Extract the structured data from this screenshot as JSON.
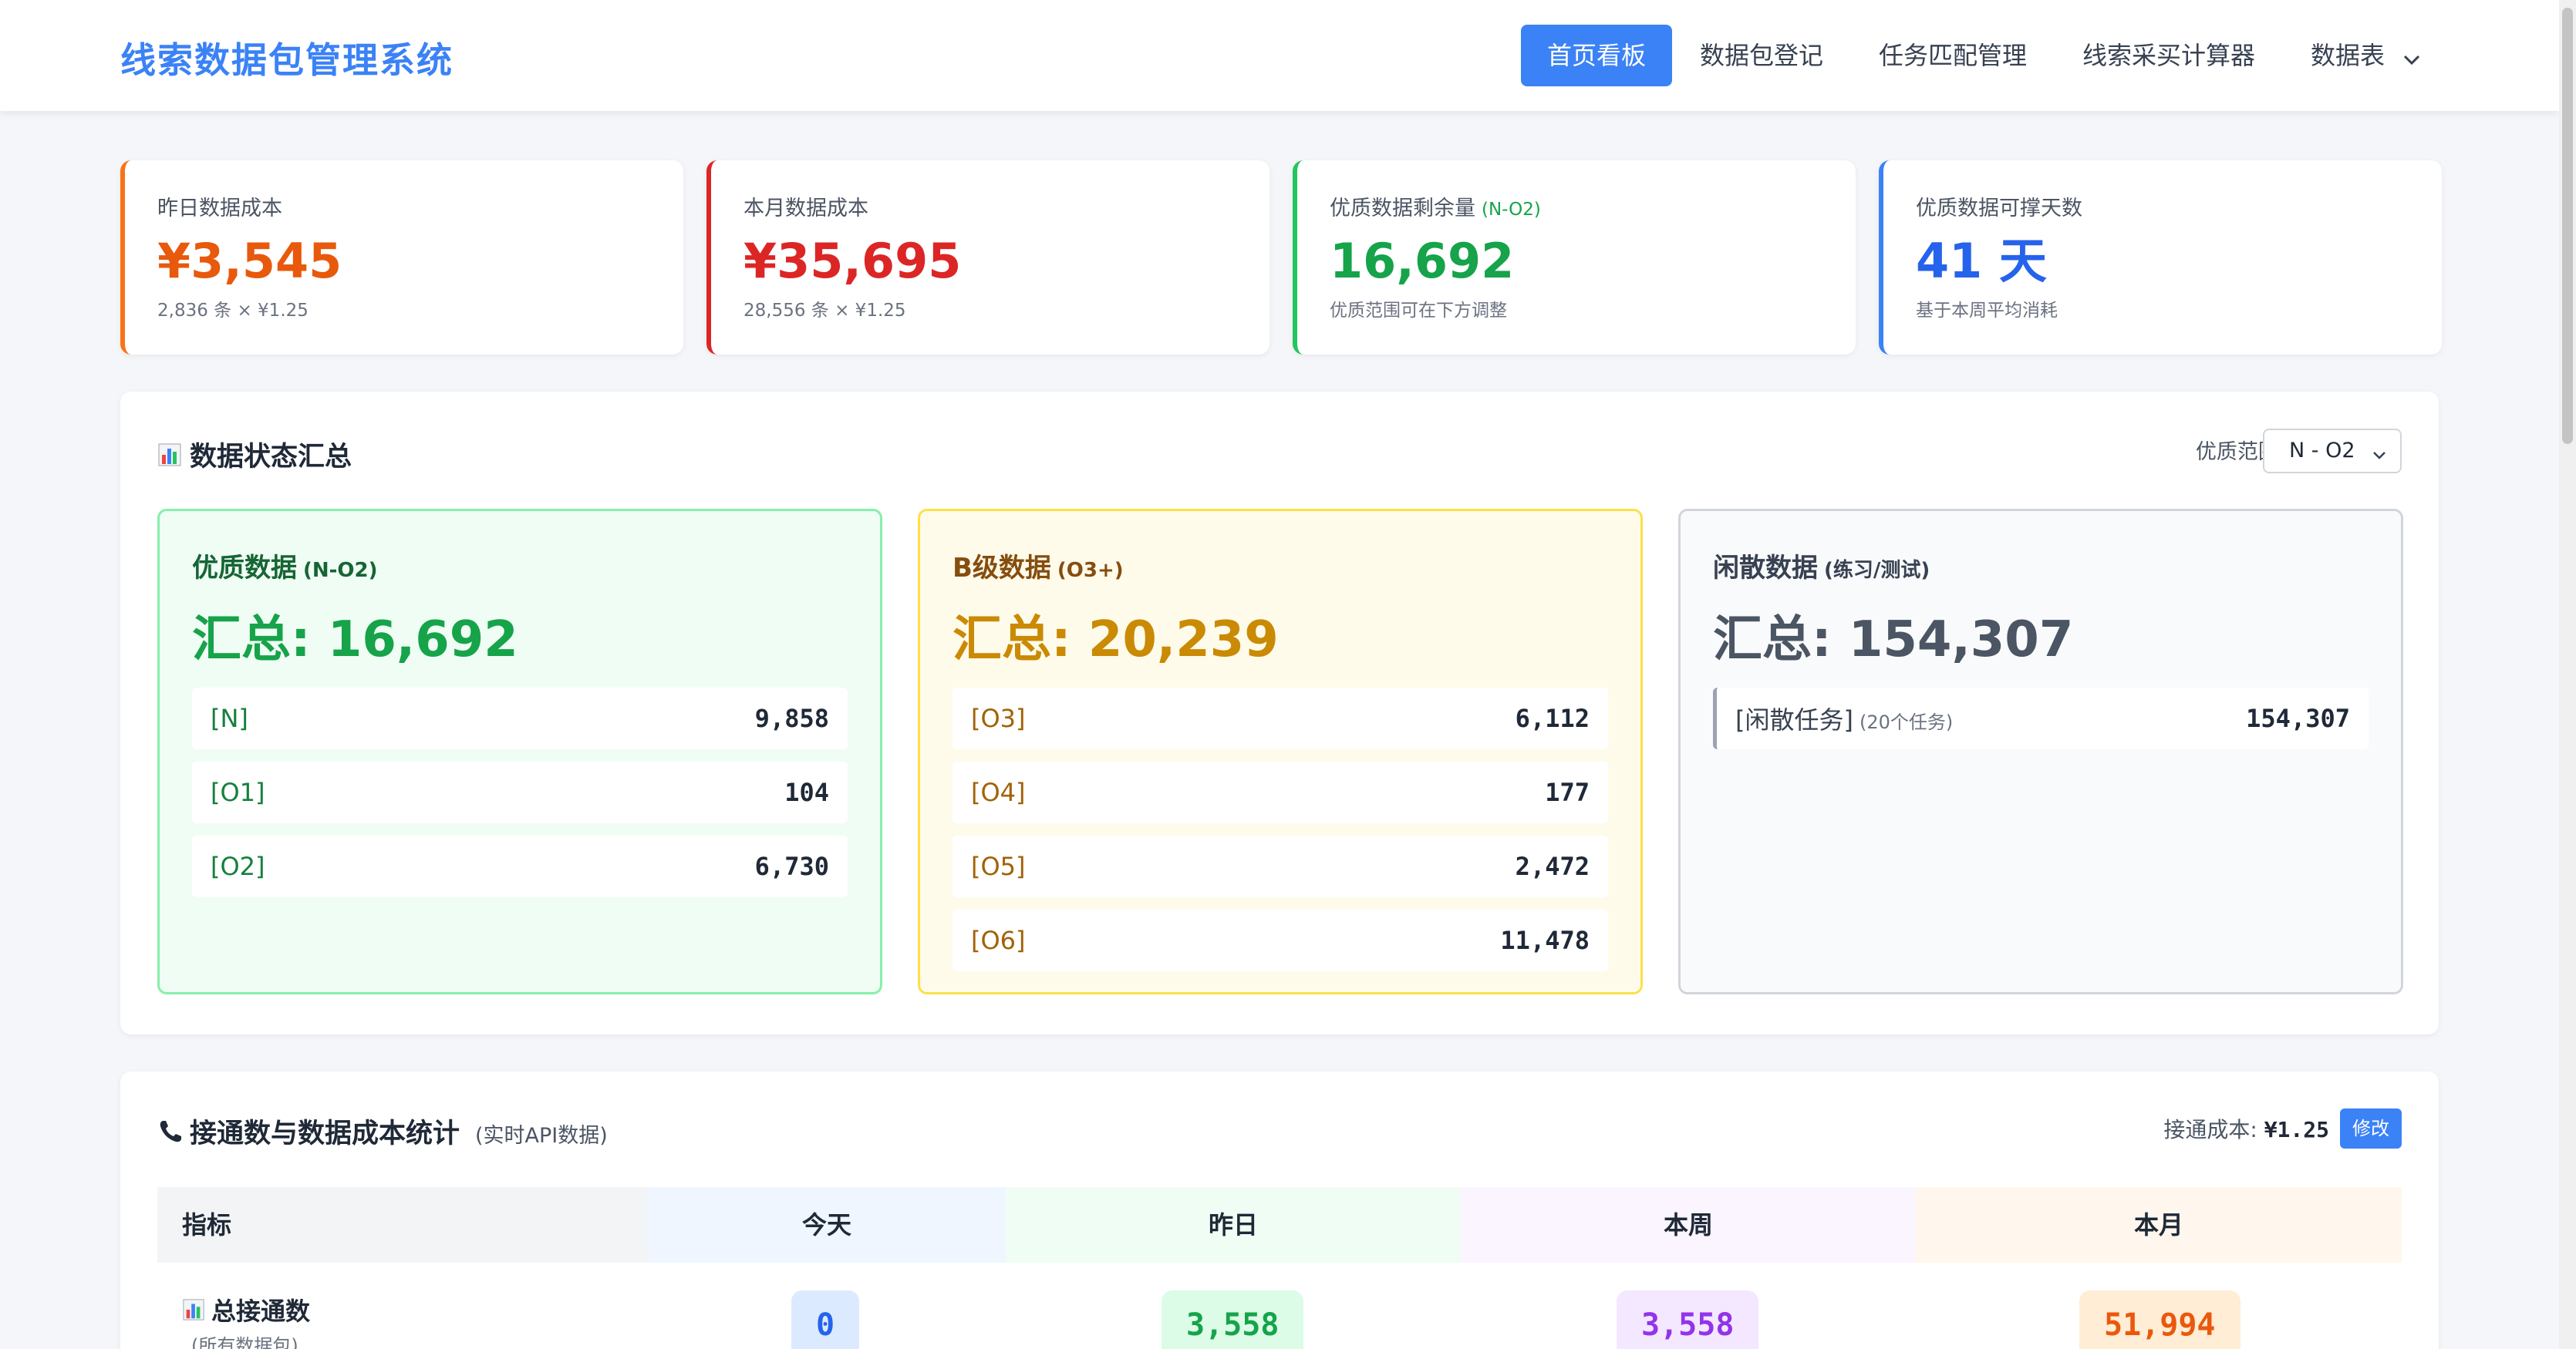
{
  "app": {
    "title": "线索数据包管理系统"
  },
  "nav": {
    "items": [
      {
        "label": "首页看板"
      },
      {
        "label": "数据包登记"
      },
      {
        "label": "任务匹配管理"
      },
      {
        "label": "线索采买计算器"
      },
      {
        "label": "数据表"
      }
    ]
  },
  "stats": [
    {
      "label": "昨日数据成本",
      "label_sub": "",
      "value": "¥3,545",
      "note": "2,836 条 × ¥1.25",
      "color": "#e8590c"
    },
    {
      "label": "本月数据成本",
      "label_sub": "",
      "value": "¥35,695",
      "note": "28,556 条 × ¥1.25",
      "color": "#dc2626"
    },
    {
      "label": "优质数据剩余量",
      "label_sub": "(N-O2)",
      "value": "16,692",
      "note": "优质范围可在下方调整",
      "color": "#16a34a"
    },
    {
      "label": "优质数据可撑天数",
      "label_sub": "",
      "value": "41 天",
      "note": "基于本周平均消耗",
      "color": "#2563eb"
    }
  ],
  "status_panel": {
    "icon": "bar-chart-icon",
    "title": "数据状态汇总",
    "range_label": "优质范围:",
    "range_value": "N - O2",
    "groups": [
      {
        "title": "优质数据",
        "title_sub": "(N-O2)",
        "total": "汇总: 16,692",
        "rows": [
          {
            "k": "[N]",
            "v": "9,858"
          },
          {
            "k": "[O1]",
            "v": "104"
          },
          {
            "k": "[O2]",
            "v": "6,730"
          }
        ]
      },
      {
        "title": "B级数据",
        "title_sub": "(O3+)",
        "total": "汇总: 20,239",
        "rows": [
          {
            "k": "[O3]",
            "v": "6,112"
          },
          {
            "k": "[O4]",
            "v": "177"
          },
          {
            "k": "[O5]",
            "v": "2,472"
          },
          {
            "k": "[O6]",
            "v": "11,478"
          }
        ]
      },
      {
        "title": "闲散数据",
        "title_sub": "(练习/测试)",
        "total": "汇总: 154,307",
        "rows": [
          {
            "k": "[闲散任务]",
            "k_sub": "(20个任务)",
            "v": "154,307"
          }
        ]
      }
    ]
  },
  "calls_panel": {
    "icon": "phone-icon",
    "title": "接通数与数据成本统计",
    "hint": "(实时API数据)",
    "cost_label": "接通成本:",
    "cost_value": "¥1.25",
    "edit_label": "修改",
    "headers": [
      "指标",
      "今天",
      "昨日",
      "本周",
      "本月"
    ],
    "row": {
      "label": "总接通数",
      "sub": "(所有数据包)",
      "values": [
        "0",
        "3,558",
        "3,558",
        "51,994"
      ]
    }
  }
}
